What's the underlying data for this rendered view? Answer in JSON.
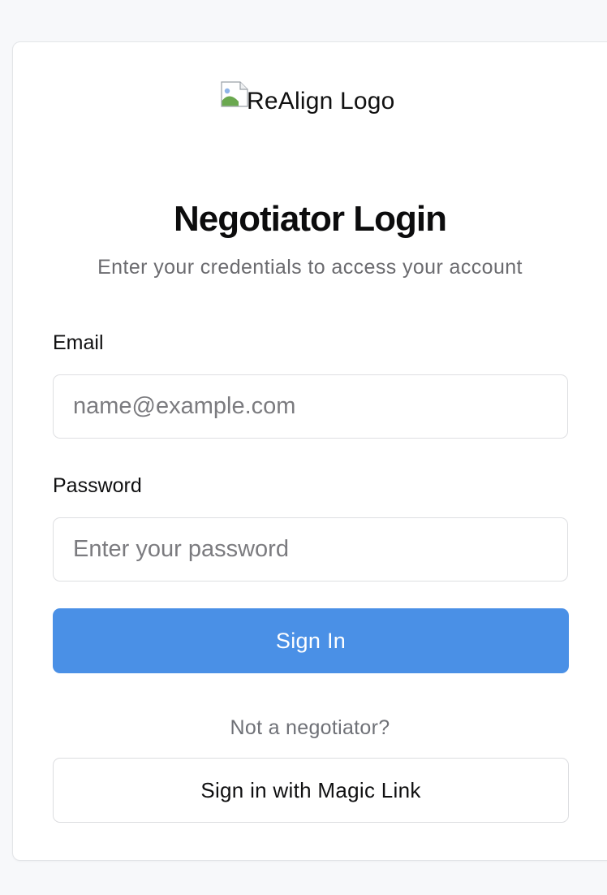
{
  "logo": {
    "alt_text": "ReAlign Logo",
    "icon": "broken-image-icon"
  },
  "header": {
    "title": "Negotiator Login",
    "subtitle": "Enter your credentials to access your account"
  },
  "form": {
    "email_label": "Email",
    "email_placeholder": "name@example.com",
    "email_value": "",
    "password_label": "Password",
    "password_placeholder": "Enter your password",
    "password_value": "",
    "submit_label": "Sign In"
  },
  "alternate": {
    "prompt": "Not a negotiator?",
    "magic_link_label": "Sign in with Magic Link"
  },
  "colors": {
    "primary": "#4a90e6",
    "page_background": "#f7f8fa",
    "card_background": "#ffffff",
    "muted_text": "#6b6b6f"
  }
}
